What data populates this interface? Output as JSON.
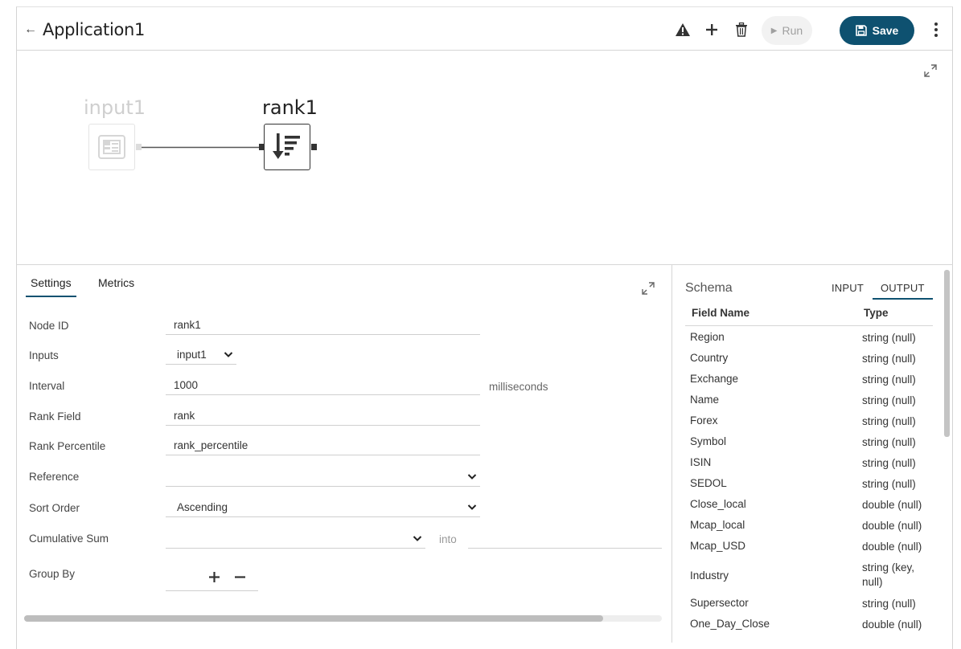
{
  "header": {
    "back_glyph": "←",
    "title": "Application1",
    "icons": [
      "warning-icon",
      "plus-icon",
      "trash-icon"
    ],
    "run_label": "Run",
    "save_label": "Save"
  },
  "canvas": {
    "nodes": [
      {
        "label": "input1",
        "icon": "table-icon",
        "state": "disabled"
      },
      {
        "label": "rank1",
        "icon": "sort-descending-icon",
        "state": "selected"
      }
    ]
  },
  "settings": {
    "tabs": [
      "Settings",
      "Metrics"
    ],
    "active_tab": "Settings",
    "node_id_label": "Node ID",
    "node_id_value": "rank1",
    "inputs_label": "Inputs",
    "inputs_value": "input1",
    "interval_label": "Interval",
    "interval_value": "1000",
    "interval_unit": "milliseconds",
    "rank_field_label": "Rank Field",
    "rank_field_value": "rank",
    "rank_percentile_label": "Rank Percentile",
    "rank_percentile_value": "rank_percentile",
    "reference_label": "Reference",
    "reference_value": "",
    "sort_order_label": "Sort Order",
    "sort_order_value": "Ascending",
    "cumulative_sum_label": "Cumulative Sum",
    "cumulative_sum_value": "",
    "into_label": "into",
    "into_value": "",
    "group_by_label": "Group By"
  },
  "schema": {
    "title": "Schema",
    "tabs": [
      "INPUT",
      "OUTPUT"
    ],
    "active_tab": "OUTPUT",
    "col_field": "Field Name",
    "col_type": "Type",
    "rows": [
      {
        "name": "Region",
        "type": "string (null)"
      },
      {
        "name": "Country",
        "type": "string (null)"
      },
      {
        "name": "Exchange",
        "type": "string (null)"
      },
      {
        "name": "Name",
        "type": "string (null)"
      },
      {
        "name": "Forex",
        "type": "string (null)"
      },
      {
        "name": "Symbol",
        "type": "string (null)"
      },
      {
        "name": "ISIN",
        "type": "string (null)"
      },
      {
        "name": "SEDOL",
        "type": "string (null)"
      },
      {
        "name": "Close_local",
        "type": "double (null)"
      },
      {
        "name": "Mcap_local",
        "type": "double (null)"
      },
      {
        "name": "Mcap_USD",
        "type": "double (null)"
      },
      {
        "name": "Industry",
        "type": "string (key, null)"
      },
      {
        "name": "Supersector",
        "type": "string (null)"
      },
      {
        "name": "One_Day_Close",
        "type": "double (null)"
      }
    ]
  },
  "colors": {
    "accent": "#0e5170",
    "run_disabled_bg": "#f2f2f2"
  }
}
